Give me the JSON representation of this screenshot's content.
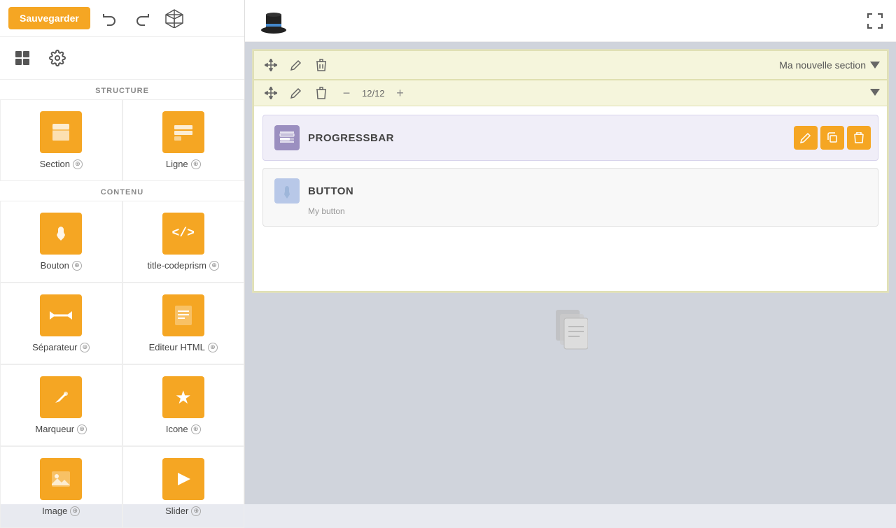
{
  "sidebar": {
    "save_button": "Sauvegarder",
    "structure_label": "STRUCTURE",
    "content_label": "CONTENU",
    "structure_items": [
      {
        "id": "section",
        "label": "Section",
        "icon": "⊞"
      },
      {
        "id": "ligne",
        "label": "Ligne",
        "icon": "⊟"
      }
    ],
    "content_items": [
      {
        "id": "bouton",
        "label": "Bouton",
        "icon": "👆"
      },
      {
        "id": "codeprism",
        "label": "title-codeprism",
        "icon": "</>"
      },
      {
        "id": "separateur",
        "label": "Séparateur",
        "icon": "↔"
      },
      {
        "id": "editeur-html",
        "label": "Editeur HTML",
        "icon": "📄"
      },
      {
        "id": "marqueur",
        "label": "Marqueur",
        "icon": "✏️"
      },
      {
        "id": "icone",
        "label": "Icone",
        "icon": "★"
      },
      {
        "id": "image",
        "label": "Image",
        "icon": "🖼"
      },
      {
        "id": "slider",
        "label": "Slider",
        "icon": "▶"
      }
    ]
  },
  "canvas": {
    "section_name": "Ma nouvelle section",
    "row_counter": "12/12",
    "progressbar": {
      "title": "PROGRESSBAR"
    },
    "button_widget": {
      "title": "BUTTON",
      "subtitle": "My button"
    }
  },
  "toolbar": {
    "move_icon": "⊕",
    "edit_icon": "✏",
    "delete_icon": "🗑",
    "minus_icon": "−",
    "plus_icon": "+",
    "dropdown_icon": "▾",
    "fullscreen_icon": "⛶"
  }
}
